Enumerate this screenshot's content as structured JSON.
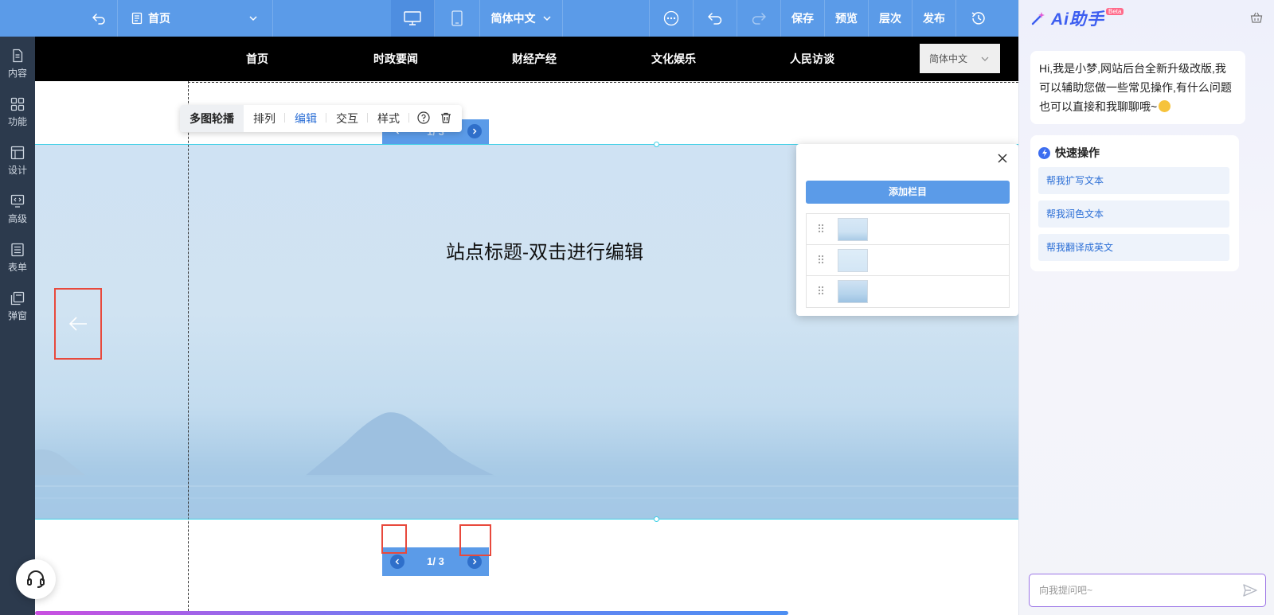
{
  "topbar": {
    "page_select": "首页",
    "language": "简体中文",
    "save": "保存",
    "preview": "预览",
    "layers": "层次",
    "publish": "发布"
  },
  "leftbar": {
    "items": [
      "内容",
      "功能",
      "设计",
      "高级",
      "表单",
      "弹窗"
    ]
  },
  "site": {
    "nav": [
      "首页",
      "时政要闻",
      "财经产经",
      "文化娱乐",
      "人民访谈"
    ],
    "language": "简体中文",
    "banner_title": "站点标题-双击进行编辑",
    "pager_top": "1/ 3",
    "pager_bottom": "1/ 3",
    "dots_total": 3,
    "dots_active": 1
  },
  "component_toolbar": {
    "name": "多图轮播",
    "items": [
      "排列",
      "编辑",
      "交互",
      "样式"
    ],
    "active": "编辑"
  },
  "popup": {
    "add_button": "添加栏目",
    "slides": 3
  },
  "ai": {
    "title": "Ai助手",
    "beta": "Beta",
    "greeting": "Hi,我是小梦,网站后台全新升级改版,我可以辅助您做一些常见操作,有什么问题也可以直接和我聊聊哦~",
    "quick_title": "快速操作",
    "quick_actions": [
      "帮我扩写文本",
      "帮我润色文本",
      "帮我翻译成英文"
    ],
    "input_placeholder": "向我提问吧~"
  },
  "colors": {
    "primary": "#5b9be8",
    "sidebar": "#2c3a4d",
    "highlight_red": "#e8493c",
    "selection_cyan": "#3ed0e6"
  }
}
